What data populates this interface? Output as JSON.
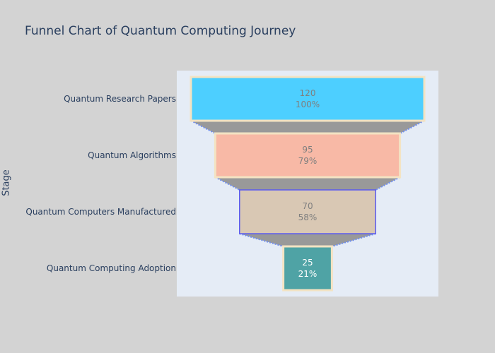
{
  "chart_data": {
    "type": "funnel",
    "title": "Funnel Chart of Quantum Computing Journey",
    "ylabel": "Stage",
    "stages": [
      "Quantum Research Papers",
      "Quantum Algorithms",
      "Quantum Computers Manufactured",
      "Quantum Computing Adoption"
    ],
    "values": [
      120,
      95,
      70,
      25
    ],
    "percent_labels": [
      "100%",
      "79%",
      "58%",
      "21%"
    ],
    "colors": [
      "#4dcfff",
      "#f8b9a6",
      "#d9c8b4",
      "#4fa3a5"
    ],
    "outline_colors": [
      "#f3e3c3",
      "#f3e3c3",
      "#5b5bf0",
      "#f3e3c3"
    ],
    "text_colors": [
      "#7f7f7f",
      "#7f7f7f",
      "#7f7f7f",
      "#ffffff"
    ],
    "connector_color": "#999999",
    "plot_background": "#e5ecf6",
    "page_background": "#d3d3d3"
  }
}
